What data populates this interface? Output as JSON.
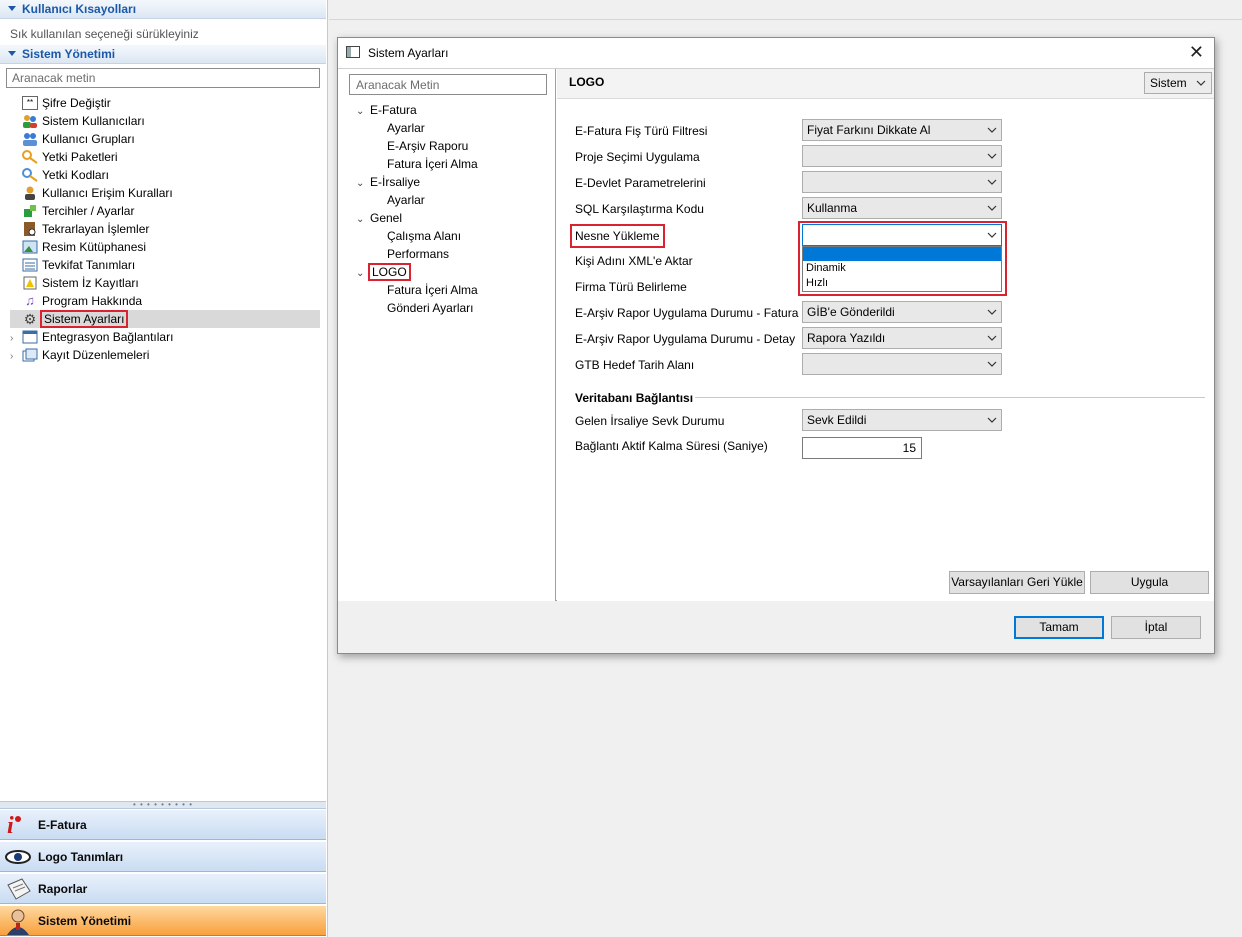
{
  "left_panel": {
    "shortcuts_header": "Kullanıcı Kısayolları",
    "shortcuts_hint": "Sık kullanılan seçeneği sürükleyiniz",
    "system_header": "Sistem Yönetimi",
    "search_placeholder": "Aranacak metin",
    "items": [
      {
        "label": "Şifre Değiştir",
        "icon": "password-icon"
      },
      {
        "label": "Sistem Kullanıcıları",
        "icon": "users-icon"
      },
      {
        "label": "Kullanıcı Grupları",
        "icon": "user-group-icon"
      },
      {
        "label": "Yetki Paketleri",
        "icon": "key-package-icon"
      },
      {
        "label": "Yetki Kodları",
        "icon": "key-icon"
      },
      {
        "label": "Kullanıcı Erişim Kuralları",
        "icon": "access-rules-icon"
      },
      {
        "label": "Tercihler / Ayarlar",
        "icon": "preferences-icon"
      },
      {
        "label": "Tekrarlayan İşlemler",
        "icon": "recurring-icon"
      },
      {
        "label": "Resim Kütüphanesi",
        "icon": "image-library-icon"
      },
      {
        "label": "Tevkifat Tanımları",
        "icon": "withholding-icon"
      },
      {
        "label": "Sistem İz Kayıtları",
        "icon": "audit-log-icon"
      },
      {
        "label": "Program Hakkında",
        "icon": "music-note-icon"
      },
      {
        "label": "Sistem Ayarları",
        "icon": "gear-icon"
      },
      {
        "label": "Entegrasyon Bağlantıları",
        "icon": "integration-icon"
      },
      {
        "label": "Kayıt Düzenlemeleri",
        "icon": "records-icon"
      }
    ],
    "nav_buttons": [
      {
        "label": "E-Fatura",
        "icon": "efatura-logo-icon"
      },
      {
        "label": "Logo Tanımları",
        "icon": "eye-icon"
      },
      {
        "label": "Raporlar",
        "icon": "report-icon"
      },
      {
        "label": "Sistem Yönetimi",
        "icon": "admin-user-icon"
      }
    ]
  },
  "dialog": {
    "title": "Sistem Ayarları",
    "search_placeholder": "Aranacak Metin",
    "tree": {
      "efatura": "E-Fatura",
      "efatura_ayarlar": "Ayarlar",
      "efatura_earsiv": "E-Arşiv Raporu",
      "efatura_fatura": "Fatura İçeri Alma",
      "eirsaliye": "E-İrsaliye",
      "eirsaliye_ayarlar": "Ayarlar",
      "genel": "Genel",
      "genel_calisma": "Çalışma Alanı",
      "genel_performans": "Performans",
      "logo": "LOGO",
      "logo_fatura": "Fatura İçeri Alma",
      "logo_gonderi": "Gönderi Ayarları"
    },
    "content": {
      "title": "LOGO",
      "scope_value": "Sistem",
      "rows": {
        "r1_label": "E-Fatura Fiş Türü Filtresi",
        "r1_value": "Fiyat Farkını Dikkate Al",
        "r2_label": "Proje Seçimi Uygulama",
        "r2_value": "",
        "r3_label": "E-Devlet Parametrelerini",
        "r3_value": "",
        "r4_label": "SQL Karşılaştırma Kodu",
        "r4_value": "Kullanma",
        "r5_label": "Nesne Yükleme",
        "r5_value": "",
        "r6_label": "Kişi Adını XML'e Aktar",
        "r7_label": "Firma Türü Belirleme",
        "r8_label": "E-Arşiv Rapor Uygulama Durumu - Fatura",
        "r8_value": "GİB'e Gönderildi",
        "r9_label": "E-Arşiv Rapor Uygulama Durumu - Detay",
        "r9_value": "Rapora Yazıldı",
        "r10_label": "GTB Hedef Tarih Alanı",
        "r10_value": ""
      },
      "dropdown_options": [
        "",
        "Dinamik",
        "Hızlı"
      ],
      "group_title": "Veritabanı Bağlantısı",
      "gelen_label": "Gelen İrsaliye Sevk Durumu",
      "gelen_value": "Sevk Edildi",
      "baglanti_label": "Bağlantı Aktif Kalma Süresi (Saniye)",
      "baglanti_value": "15",
      "restore_button": "Varsayılanları Geri Yükle",
      "apply_button": "Uygula"
    },
    "ok_button": "Tamam",
    "cancel_button": "İptal"
  },
  "colors": {
    "highlight_red": "#d9232e",
    "selection_blue": "#0078d7",
    "header_blue": "#1c58a8",
    "active_nav_orange": "#f8a03c"
  }
}
